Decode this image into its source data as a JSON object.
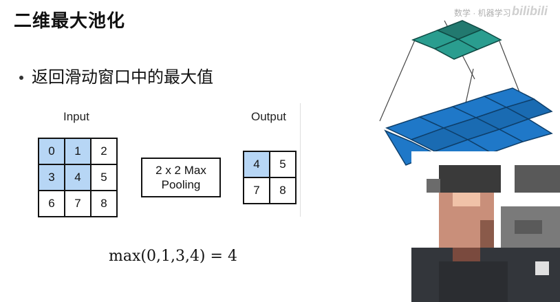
{
  "slide": {
    "title": "二维最大池化",
    "bullet": "返回滑动窗口中的最大值"
  },
  "input": {
    "label": "Input",
    "grid": [
      [
        "0",
        "1",
        "2"
      ],
      [
        "3",
        "4",
        "5"
      ],
      [
        "6",
        "7",
        "8"
      ]
    ]
  },
  "pooling": {
    "line1": "2 x 2 Max",
    "line2": "Pooling"
  },
  "output": {
    "label": "Output",
    "grid": [
      [
        "4",
        "5"
      ],
      [
        "7",
        "8"
      ]
    ]
  },
  "formula": "max(0,1,3,4) = 4",
  "watermark": {
    "text": "数学 · 机器学习",
    "logo": "bilibili"
  },
  "colors": {
    "highlight": "#b7d6f5",
    "pool_top": "#2a9d8f",
    "pool_base": "#1f78c8"
  }
}
